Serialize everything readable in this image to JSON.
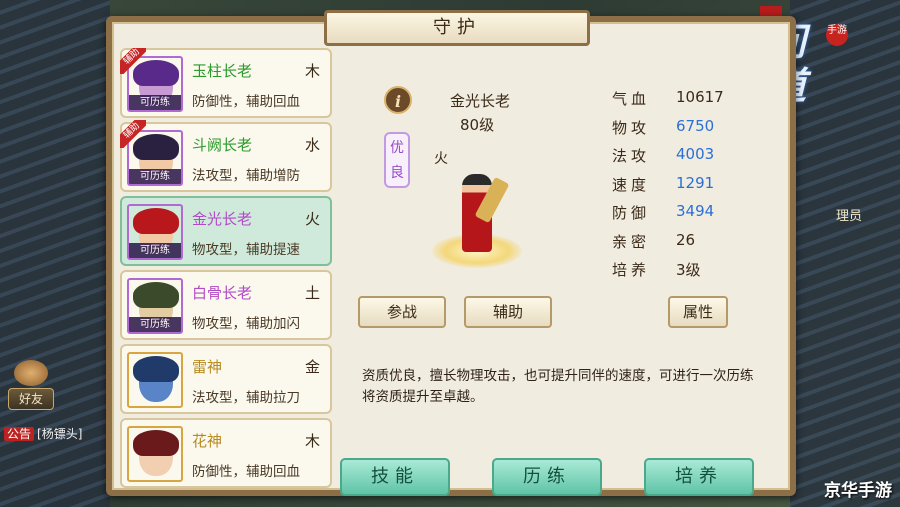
{
  "dialog": {
    "title": "守护",
    "close_icon": "close-icon"
  },
  "companions": [
    {
      "name": "玉柱长老",
      "element": "木",
      "desc": "防御性，辅助回血",
      "tag": "可历练",
      "assist": "辅助",
      "name_color": "#2a9a2a",
      "frame": "purple",
      "skin": "#c79ad3",
      "hair": "#5a2a8a"
    },
    {
      "name": "斗阙长老",
      "element": "水",
      "desc": "法攻型，辅助增防",
      "tag": "可历练",
      "assist": "辅助",
      "name_color": "#2a9a2a",
      "frame": "purple",
      "skin": "#f1c9a5",
      "hair": "#2a2040"
    },
    {
      "name": "金光长老",
      "element": "火",
      "desc": "物攻型，辅助提速",
      "tag": "可历练",
      "assist": "",
      "name_color": "#b24ac8",
      "frame": "purple",
      "skin": "#f1c9a5",
      "hair": "#b8171c"
    },
    {
      "name": "白骨长老",
      "element": "土",
      "desc": "物攻型，辅助加闪",
      "tag": "可历练",
      "assist": "",
      "name_color": "#b24ac8",
      "frame": "purple",
      "skin": "#e3cba2",
      "hair": "#3a4a2a"
    },
    {
      "name": "雷神",
      "element": "金",
      "desc": "法攻型，辅助拉刀",
      "tag": "",
      "assist": "",
      "name_color": "#b88a20",
      "frame": "gold",
      "skin": "#5a84c8",
      "hair": "#203a6a"
    },
    {
      "name": "花神",
      "element": "木",
      "desc": "防御性，辅助回血",
      "tag": "",
      "assist": "",
      "name_color": "#b88a20",
      "frame": "gold",
      "skin": "#f3cfb2",
      "hair": "#6a1a1a"
    }
  ],
  "detail": {
    "name": "金光长老",
    "level": "80级",
    "quality": "优良",
    "element": "火",
    "info_icon_glyph": "i",
    "stats": [
      {
        "key": "气血",
        "value": "10617",
        "highlight": false
      },
      {
        "key": "物攻",
        "value": "6750",
        "highlight": true
      },
      {
        "key": "法攻",
        "value": "4003",
        "highlight": true
      },
      {
        "key": "速度",
        "value": "1291",
        "highlight": true
      },
      {
        "key": "防御",
        "value": "3494",
        "highlight": true
      },
      {
        "key": "亲密",
        "value": "26",
        "highlight": false
      },
      {
        "key": "培养",
        "value": "3级",
        "highlight": false
      }
    ],
    "btn_fight": "参战",
    "btn_assist": "辅助",
    "btn_attr": "属性",
    "description": "资质优良，擅长物理攻击，也可提升同伴的速度，可进行一次历练将资质提升至卓越。",
    "btn_skill": "技能",
    "btn_train": "历练",
    "btn_cultivate": "培养"
  },
  "side": {
    "friend": "好友",
    "announce_tag": "公告",
    "announce_text": "[杨镖头]",
    "manager": "理员",
    "logo_text": "问道",
    "logo_badge": "手游",
    "watermark": "京华手游"
  },
  "colors": {
    "frame": "#8c6e47",
    "panel": "#f1ece0",
    "accent_green": "#5fc4a6",
    "stat_blue": "#2b6fd6"
  }
}
